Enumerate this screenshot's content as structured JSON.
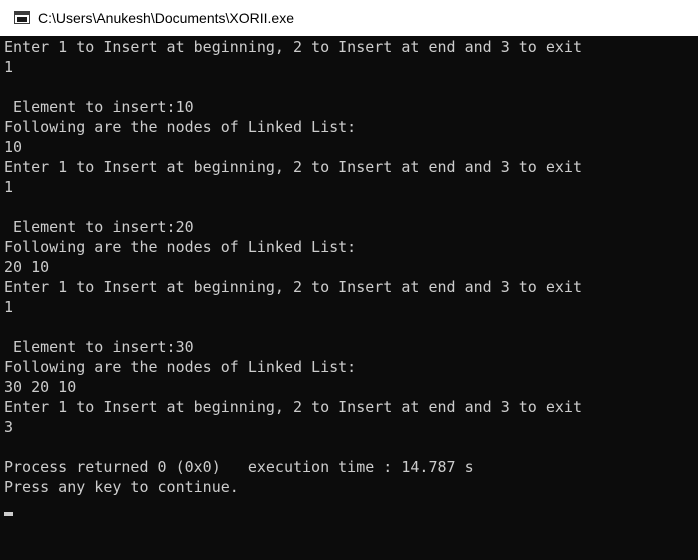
{
  "window": {
    "title": "C:\\Users\\Anukesh\\Documents\\XORII.exe",
    "icon": "console-window-icon"
  },
  "console": {
    "lines": [
      "Enter 1 to Insert at beginning, 2 to Insert at end and 3 to exit",
      "1",
      "",
      " Element to insert:10",
      "Following are the nodes of Linked List:",
      "10",
      "Enter 1 to Insert at beginning, 2 to Insert at end and 3 to exit",
      "1",
      "",
      " Element to insert:20",
      "Following are the nodes of Linked List:",
      "20 10",
      "Enter 1 to Insert at beginning, 2 to Insert at end and 3 to exit",
      "1",
      "",
      " Element to insert:30",
      "Following are the nodes of Linked List:",
      "30 20 10",
      "Enter 1 to Insert at beginning, 2 to Insert at end and 3 to exit",
      "3",
      "",
      "Process returned 0 (0x0)   execution time : 14.787 s",
      "Press any key to continue."
    ]
  },
  "colors": {
    "console_background": "#0c0c0c",
    "console_text": "#cccccc",
    "titlebar_background": "#ffffff"
  }
}
